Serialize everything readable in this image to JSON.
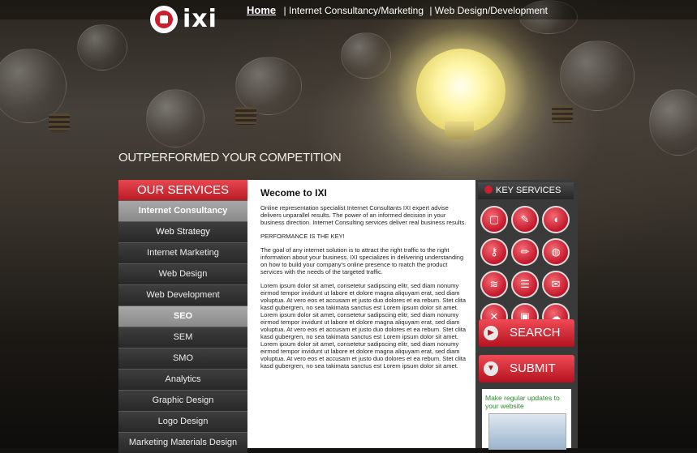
{
  "brand": {
    "name": "ixi"
  },
  "nav": {
    "home": "Home",
    "item1": "|  Internet Consultancy/Marketing",
    "item2": "  | Web Design/Development"
  },
  "hero": {
    "tagline": "OUTPERFORMED YOUR COMPETITION"
  },
  "sidebar": {
    "title": "OUR SERVICES",
    "items": [
      {
        "label": "Internet Consultancy"
      },
      {
        "label": "Web Strategy"
      },
      {
        "label": "Internet Marketing"
      },
      {
        "label": "Web Design"
      },
      {
        "label": "Web Development"
      },
      {
        "label": "SEO"
      },
      {
        "label": "SEM"
      },
      {
        "label": "SMO"
      },
      {
        "label": "Analytics"
      },
      {
        "label": "Graphic Design"
      },
      {
        "label": "Logo Design"
      },
      {
        "label": "Marketing Materials Design"
      }
    ]
  },
  "content": {
    "heading": "Wecome to IXI",
    "p1": "Online representation specialist Internet Consultants IXI expert advise delivers unparallel results. The power of an informed decision in your business direction. Internet Consulting services deliver real business results.",
    "p2": "PERFORMANCE IS THE KEY!",
    "p3": "The goal of any internet solution is to attract the right traffic to the right information about your business. IXI specializes in delivering understanding on how to build your company's online presence to match the product services with the needs of the targeted traffic.",
    "p4": "Lorem ipsum dolor sit amet, consetetur sadipscing elitr, sed diam nonumy eirmod tempor invidunt ut labore et dolore magna aliquyam erat, sed diam voluptua. At vero eos et accusam et justo duo dolores et ea rebum. Stet clita kasd gubergren, no sea takimata sanctus est Lorem ipsum dolor sit amet. Lorem ipsum dolor sit amet, consetetur sadipscing elitr, sed diam nonumy eirmod tempor invidunt ut labore et dolore magna aliquyam erat, sed diam voluptua. At vero eos et accusam et justo duo dolores et ea rebum. Stet clita kasd gubergren, no sea takimata sanctus est Lorem ipsum dolor sit amet. Lorem ipsum dolor sit amet, consetetur sadipscing elitr, sed diam nonumy eirmod tempor invidunt ut labore et dolore magna aliquyam erat, sed diam voluptua. At vero eos et accusam et justo duo dolores et ea rebum. Stet clita kasd gubergren, no sea takimata sanctus est Lorem ipsum dolor sit amet."
  },
  "key_services": {
    "title": "KEY SERVICES",
    "icons": [
      {
        "name": "screen-icon",
        "glyph": "▢"
      },
      {
        "name": "pen-icon",
        "glyph": "✎"
      },
      {
        "name": "mouse-icon",
        "glyph": "◖"
      },
      {
        "name": "key-icon",
        "glyph": "⚷"
      },
      {
        "name": "pencil-icon",
        "glyph": "✏"
      },
      {
        "name": "globe-icon",
        "glyph": "◍"
      },
      {
        "name": "signal-icon",
        "glyph": "≋"
      },
      {
        "name": "stack-icon",
        "glyph": "☰"
      },
      {
        "name": "chat-icon",
        "glyph": "✉"
      },
      {
        "name": "tools-icon",
        "glyph": "✕"
      },
      {
        "name": "devices-icon",
        "glyph": "▣"
      },
      {
        "name": "cloud-icon",
        "glyph": "☁"
      }
    ],
    "search_label": "SEARCH",
    "submit_label": "SUBMIT",
    "promo_text": "Make regular updates to your website"
  }
}
